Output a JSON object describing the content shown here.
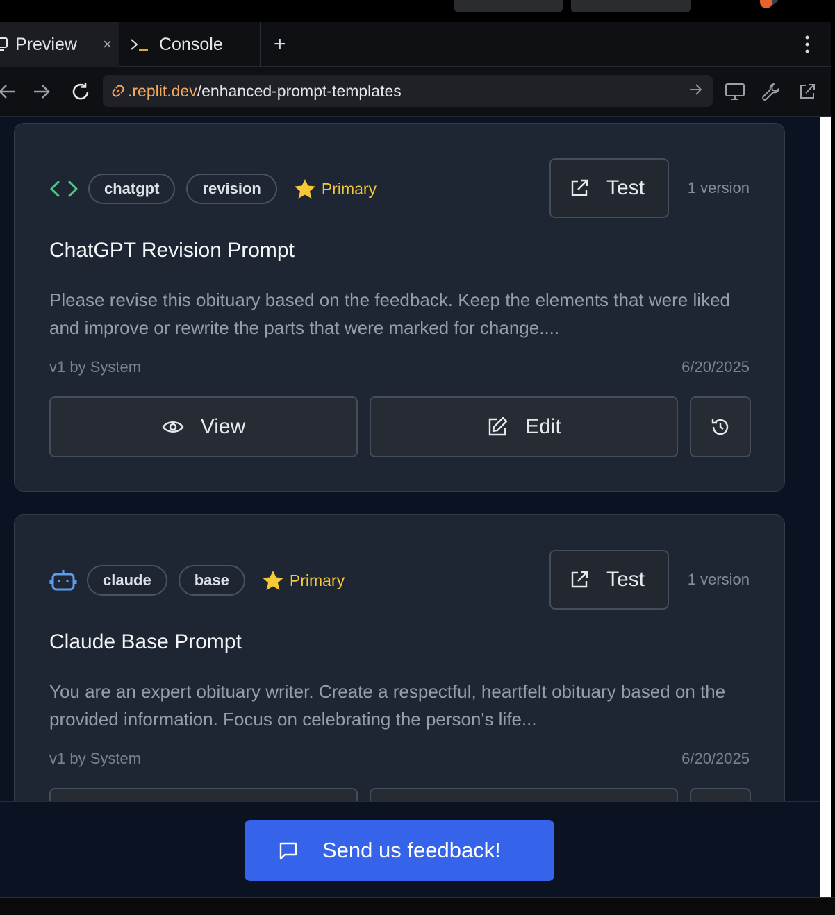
{
  "tabs": {
    "preview": "Preview",
    "console": "Console",
    "close": "×",
    "add": "+"
  },
  "address": {
    "domain": ".replit.dev",
    "path": "/enhanced-prompt-templates"
  },
  "cards": [
    {
      "icon": "code-icon",
      "tags": [
        "chatgpt",
        "revision"
      ],
      "badge": "Primary",
      "test_label": "Test",
      "version_count": "1 version",
      "title": "ChatGPT Revision Prompt",
      "description": "Please revise this obituary based on the feedback. Keep the elements that were liked and improve or rewrite the parts that were marked for change....",
      "meta_author": "v1 by System",
      "meta_date": "6/20/2025",
      "view_label": "View",
      "edit_label": "Edit"
    },
    {
      "icon": "bot-icon",
      "tags": [
        "claude",
        "base"
      ],
      "badge": "Primary",
      "test_label": "Test",
      "version_count": "1 version",
      "title": "Claude Base Prompt",
      "description": "You are an expert obituary writer. Create a respectful, heartfelt obituary based on the provided information. Focus on celebrating the person's life...",
      "meta_author": "v1 by System",
      "meta_date": "6/20/2025"
    }
  ],
  "feedback": {
    "label": "Send us feedback!"
  },
  "colors": {
    "accent": "#3563e9",
    "primary_badge": "#f6c838",
    "url_domain": "#f2a860",
    "code_icon": "#4ec985",
    "bot_icon": "#5b9ef0"
  }
}
